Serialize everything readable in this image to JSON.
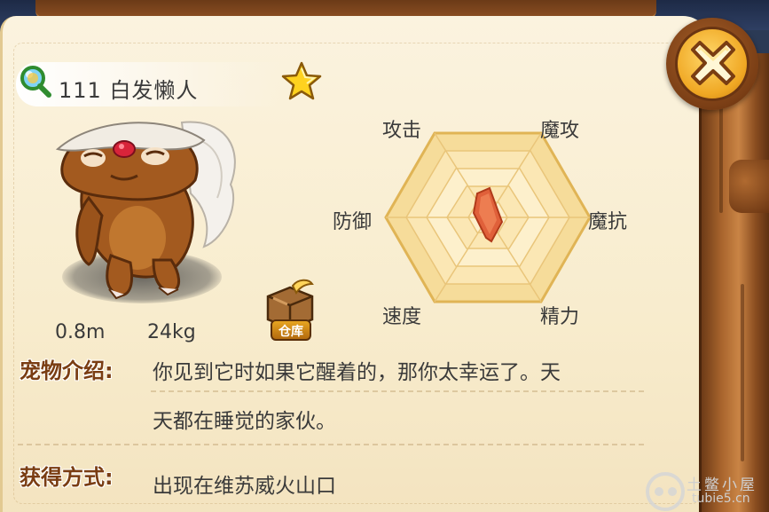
{
  "pet": {
    "name": "111 白发懒人",
    "height": "0.8m",
    "weight": "24kg"
  },
  "warehouse": {
    "label": "仓库"
  },
  "radar": {
    "labels": {
      "attack": "攻击",
      "magic_attack": "魔攻",
      "magic_resist": "魔抗",
      "energy": "精力",
      "speed": "速度",
      "defense": "防御"
    }
  },
  "intro": {
    "title": "宠物介绍:",
    "line1": "你见到它时如果它醒着的，那你太幸运了。天",
    "line2": "天都在睡觉的家伙。"
  },
  "obtain": {
    "title": "获得方式:",
    "text": "出现在维苏威火山口"
  },
  "watermark": {
    "line1": "土鳖小屋",
    "line2": "tubie5.cn"
  },
  "icons": {
    "close": "close-x-icon",
    "magnifier": "magnifier-icon",
    "favorite": "star-icon",
    "warehouse": "warehouse-box-icon"
  },
  "colors": {
    "parchment": "#f8eccd",
    "title_brown": "#7a3d12",
    "radar_fill": "#f6dc9a",
    "stat_fill": "#e0603a",
    "close_gold": "#f0a824"
  }
}
